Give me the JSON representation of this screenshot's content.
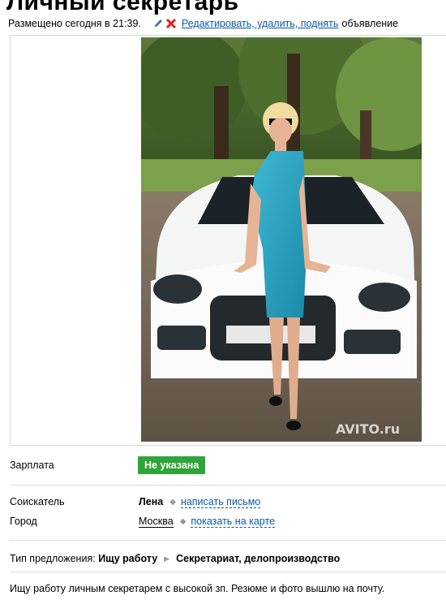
{
  "listing": {
    "title": "Личный секретарь",
    "posted": "Размещено сегодня в 21:39.",
    "edit_links": "Редактировать, удалить, поднять",
    "edit_tail": "объявление",
    "photo_watermark": "AVITO.ru"
  },
  "details": {
    "salary_label": "Зарплата",
    "salary_value": "Не указана",
    "applicant_label": "Соискатель",
    "applicant_name": "Лена",
    "write_letter": "написать письмо",
    "city_label": "Город",
    "city_name": "Москва",
    "show_map": "показать на карте",
    "offer_label": "Тип предложения:",
    "offer_type": "Ищу работу",
    "offer_category": "Секретариат, делопроизводство",
    "description": "Ищу работу личным секретарем с высокой зп. Резюме и фото вышлю на почту."
  },
  "colors": {
    "badge": "#2fa43a",
    "link": "#0b58a8",
    "divider": "#dcdcdc"
  },
  "icons": [
    "pencil-icon",
    "delete-x-icon",
    "bullet-icon",
    "arrow-icon"
  ]
}
